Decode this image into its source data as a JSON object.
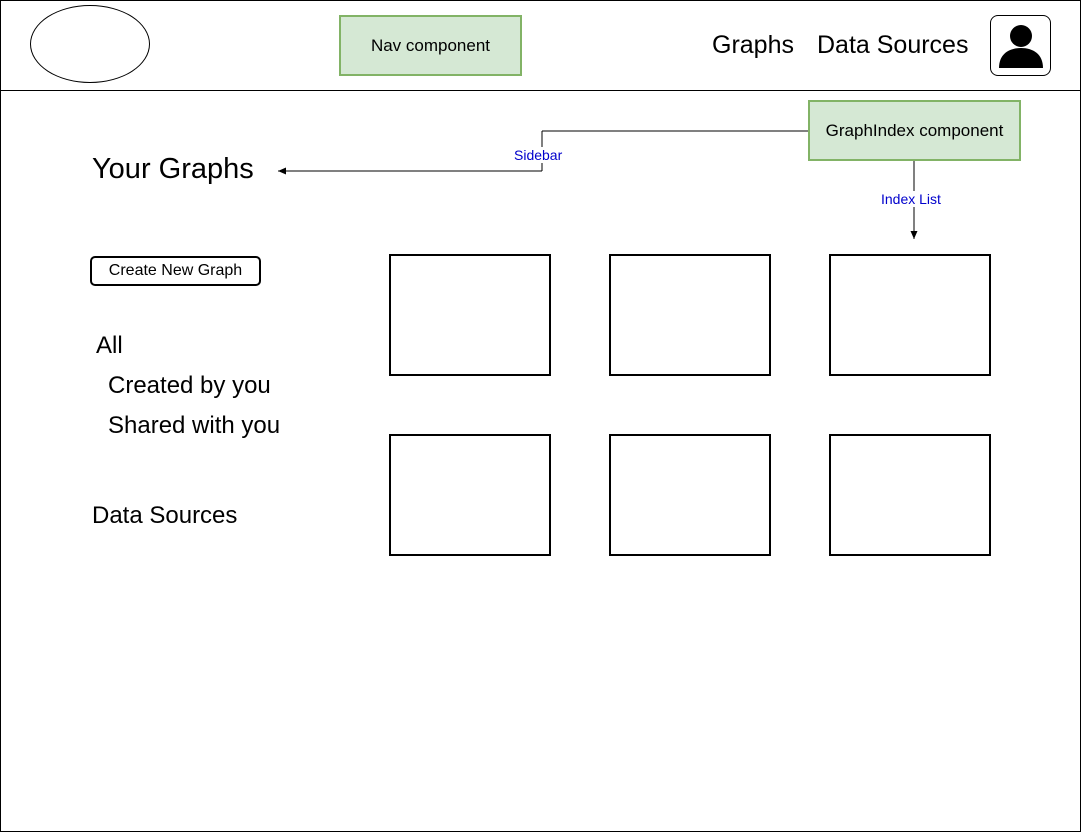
{
  "header": {
    "nav_component_label": "Nav component",
    "nav_links": [
      "Graphs",
      "Data Sources"
    ],
    "avatar_icon": "user-icon"
  },
  "annotations": {
    "sidebar": "Sidebar",
    "graph_index_component": "GraphIndex component",
    "index_list": "Index List"
  },
  "sidebar": {
    "title": "Your Graphs",
    "create_button": "Create New Graph",
    "filters": [
      "All",
      "Created by you",
      "Shared with you"
    ],
    "data_sources": "Data Sources"
  },
  "graph_grid": {
    "rows": 2,
    "columns": 3
  },
  "colors": {
    "component_fill": "#d5e8d4",
    "component_border": "#82b366",
    "annotation_text": "#0000cc"
  }
}
